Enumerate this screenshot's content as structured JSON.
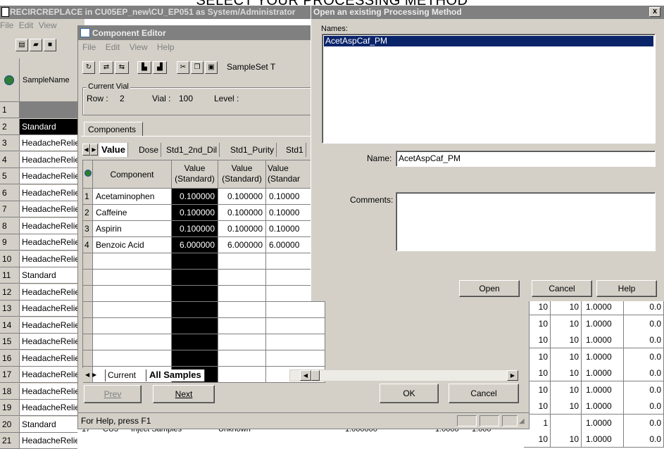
{
  "heading": "SELECT YOUR PROCESSING METHOD",
  "back_window": {
    "title": "RECIRCREPLACE in CU05EP_new\\CU_EP051 as System/Administrator",
    "menu": [
      "File",
      "Edit",
      "View"
    ],
    "grid_header": "SampleName",
    "rows": [
      {
        "n": "1",
        "name": ""
      },
      {
        "n": "2",
        "name": "Standard"
      },
      {
        "n": "3",
        "name": "HeadacheRelieve"
      },
      {
        "n": "4",
        "name": "HeadacheRelieve"
      },
      {
        "n": "5",
        "name": "HeadacheRelieve"
      },
      {
        "n": "6",
        "name": "HeadacheRelieve"
      },
      {
        "n": "7",
        "name": "HeadacheRelieve"
      },
      {
        "n": "8",
        "name": "HeadacheRelieve"
      },
      {
        "n": "9",
        "name": "HeadacheRelieve"
      },
      {
        "n": "10",
        "name": "HeadacheRelieve"
      },
      {
        "n": "11",
        "name": "Standard"
      },
      {
        "n": "12",
        "name": "HeadacheRelieve"
      },
      {
        "n": "13",
        "name": "HeadacheRelieve"
      },
      {
        "n": "14",
        "name": "HeadacheRelieve"
      },
      {
        "n": "15",
        "name": "HeadacheRelieve"
      },
      {
        "n": "16",
        "name": "HeadacheRelieve"
      },
      {
        "n": "17",
        "name": "HeadacheRelieve"
      },
      {
        "n": "18",
        "name": "HeadacheRelieve"
      },
      {
        "n": "19",
        "name": "HeadacheRelieve"
      },
      {
        "n": "20",
        "name": "Standard"
      },
      {
        "n": "21",
        "name": "HeadacheReliever"
      }
    ],
    "right_rows": [
      {
        "a": "10",
        "b": "10",
        "c": "1.0000",
        "d": "0.0"
      },
      {
        "a": "10",
        "b": "10",
        "c": "1.0000",
        "d": "0.0"
      },
      {
        "a": "10",
        "b": "10",
        "c": "1.0000",
        "d": "0.0"
      },
      {
        "a": "10",
        "b": "10",
        "c": "1.0000",
        "d": "0.0"
      },
      {
        "a": "10",
        "b": "10",
        "c": "1.0000",
        "d": "0.0"
      },
      {
        "a": "10",
        "b": "10",
        "c": "1.0000",
        "d": "0.0"
      },
      {
        "a": "10",
        "b": "10",
        "c": "1.0000",
        "d": "0.0"
      },
      {
        "a": "1",
        "b": "",
        "c": "1.0000",
        "d": "0.0"
      },
      {
        "a": "10",
        "b": "10",
        "c": "1.0000",
        "d": "0.0"
      }
    ],
    "row21_cells": [
      "17",
      "CU3",
      "Inject Samples",
      "Unknown",
      "1.000000",
      "1.0000",
      "1.000"
    ]
  },
  "component_editor": {
    "title": "Component Editor",
    "menu": [
      "File",
      "Edit",
      "View",
      "Help"
    ],
    "sampleset_label": "SampleSet T",
    "current_vial": {
      "legend": "Current Vial",
      "row_label": "Row :",
      "row_value": "2",
      "vial_label": "Vial :",
      "vial_value": "100",
      "level_label": "Level :",
      "level_value": ""
    },
    "components_tab": "Components",
    "sub_tabs": [
      "Value",
      "Dose",
      "Std1_2nd_Dil",
      "Std1_Purity",
      "Std1"
    ],
    "columns": [
      "Component",
      "Value (Standard)",
      "Value (Standard)",
      "Value (Standard)"
    ],
    "col_lines": [
      [
        "Value",
        "(Standard)"
      ],
      [
        "Value",
        "(Standard)"
      ],
      [
        "Value",
        "(Standar"
      ]
    ],
    "rows": [
      {
        "n": "1",
        "name": "Acetaminophen",
        "v1": "0.100000",
        "v2": "0.100000",
        "v3": "0.10000"
      },
      {
        "n": "2",
        "name": "Caffeine",
        "v1": "0.100000",
        "v2": "0.100000",
        "v3": "0.10000"
      },
      {
        "n": "3",
        "name": "Aspirin",
        "v1": "0.100000",
        "v2": "0.100000",
        "v3": "0.10000"
      },
      {
        "n": "4",
        "name": "Benzoic Acid",
        "v1": "6.000000",
        "v2": "6.000000",
        "v3": "6.00000"
      }
    ],
    "bottom_tabs": [
      "Current",
      "All Samples"
    ],
    "prev_label": "Prev",
    "next_label": "Next",
    "ok_label": "OK",
    "cancel_label": "Cancel",
    "status": "For Help, press F1"
  },
  "open_dialog": {
    "title": "Open an existing Processing Method",
    "names_label": "Names:",
    "names": [
      "AcetAspCaf_PM"
    ],
    "name_label": "Name:",
    "name_value": "AcetAspCaf_PM",
    "comments_label": "Comments:",
    "comments_value": "",
    "open_label": "Open",
    "cancel_label": "Cancel",
    "help_label": "Help",
    "close_glyph": "x"
  }
}
